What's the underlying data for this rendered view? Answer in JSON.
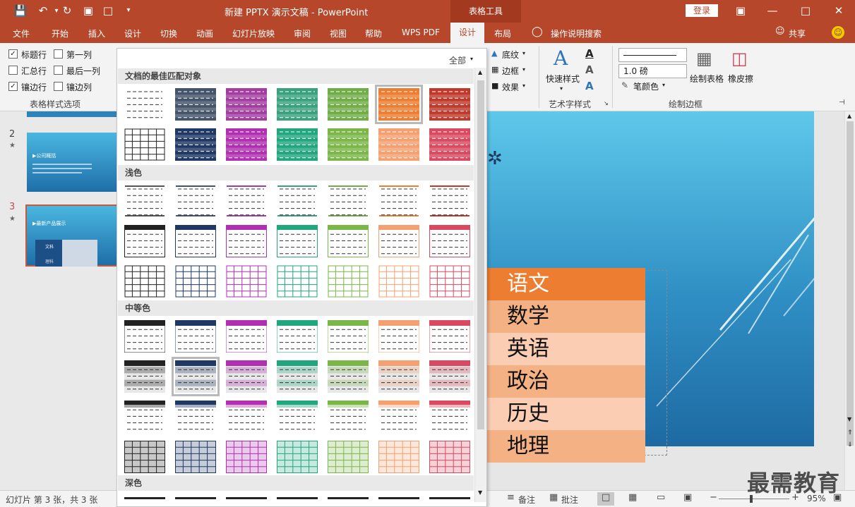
{
  "window": {
    "title": "新建 PPTX 演示文稿 - PowerPoint",
    "context_tab": "表格工具",
    "login": "登录"
  },
  "tabs": [
    "文件",
    "开始",
    "插入",
    "设计",
    "切换",
    "动画",
    "幻灯片放映",
    "审阅",
    "视图",
    "帮助",
    "WPS PDF",
    "设计",
    "布局"
  ],
  "tell_me": "操作说明搜索",
  "share": "共享",
  "ribbon": {
    "options": [
      {
        "label": "标题行",
        "checked": true
      },
      {
        "label": "汇总行",
        "checked": false
      },
      {
        "label": "镶边行",
        "checked": true
      },
      {
        "label": "第一列",
        "checked": false
      },
      {
        "label": "最后一列",
        "checked": false
      },
      {
        "label": "镶边列",
        "checked": false
      }
    ],
    "options_group": "表格样式选项",
    "shading": "底纹",
    "borders": "边框",
    "effects": "效果",
    "quick_styles": "快速样式",
    "wordart_group": "艺术字样式",
    "pen_weight": "1.0 磅",
    "pen_color": "笔颜色",
    "draw_table": "绘制表格",
    "eraser": "橡皮擦",
    "draw_group": "绘制边框"
  },
  "gallery": {
    "filter": "全部",
    "sections": [
      "文档的最佳匹配对象",
      "浅色",
      "中等色",
      "深色"
    ]
  },
  "thumbnails": [
    {
      "num": "2",
      "title": "▶公司概括"
    },
    {
      "num": "3",
      "title": "▶最新产品展示",
      "cell1": "文科",
      "cell2": "理科"
    }
  ],
  "table_rows": [
    "语文",
    "数学",
    "英语",
    "政治",
    "历史",
    "地理"
  ],
  "status": {
    "slide_info": "幻灯片 第 3 张，共 3 张",
    "notes": "备注",
    "comments": "批注",
    "zoom": "95%"
  },
  "watermark": "最需教育",
  "colors": {
    "accent": "#b7472a",
    "table_header": "#ed7d31"
  }
}
